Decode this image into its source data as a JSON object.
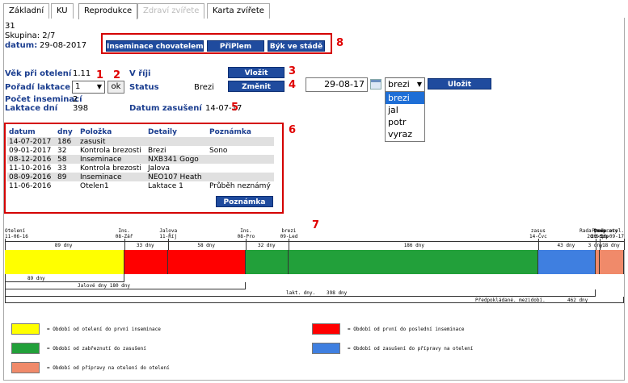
{
  "tabs": [
    {
      "label": "Základní",
      "state": "normal"
    },
    {
      "label": "KU",
      "state": "normal"
    },
    {
      "label": "Reprodukce",
      "state": "active"
    },
    {
      "label": "Zdraví zvířete",
      "state": "disabled"
    },
    {
      "label": "Karta zvířete",
      "state": "normal"
    }
  ],
  "header": {
    "number": "31",
    "group": "Skupina: 2/7",
    "date_label": "datum:",
    "date_value": "29-08-2017"
  },
  "top_buttons": [
    "Inseminace chovatelem",
    "PřiPlem",
    "Býk ve stádě"
  ],
  "form": {
    "age_label": "Věk při otelení",
    "age_value": "1.11",
    "heat_label": "V říji",
    "heat_button": "Vložit",
    "lact_order_label": "Pořadí laktace",
    "lact_order_value": "1",
    "ok_label": "ok",
    "status_label": "Status",
    "status_value": "Brezi",
    "change_button": "Změnit",
    "status_date": "29-08-17",
    "status_select": "brezi",
    "status_options": [
      "brezi",
      "jal",
      "potr",
      "vyraz"
    ],
    "save_button": "Uložit",
    "insem_count_label": "Počet inseminací",
    "insem_count_value": "2",
    "lact_days_label": "Laktace dní",
    "lact_days_value": "398",
    "conception_label": "Datum zasušení",
    "conception_value": "14-07-17"
  },
  "annotations": [
    "1",
    "2",
    "3",
    "4",
    "5",
    "6",
    "7",
    "8"
  ],
  "events_table": {
    "headers": [
      "datum",
      "dny",
      "Položka",
      "Detaily",
      "Poznámka"
    ],
    "rows": [
      [
        "14-07-2017",
        "186",
        "zasusit",
        "",
        ""
      ],
      [
        "09-01-2017",
        "32",
        "Kontrola brezosti",
        "Brezi",
        "Sono"
      ],
      [
        "08-12-2016",
        "58",
        "Inseminace",
        "NXB341 Gogo",
        ""
      ],
      [
        "11-10-2016",
        "33",
        "Kontrola brezosti",
        "Jalova",
        ""
      ],
      [
        "08-09-2016",
        "89",
        "Inseminace",
        "NEO107 Heath",
        ""
      ],
      [
        "11-06-2016",
        "",
        "Otelen1",
        "Laktace 1",
        "Průběh neznámý"
      ]
    ],
    "note_button": "Poznámka"
  },
  "timeline": {
    "top_labels": [
      {
        "l1": "Otelení",
        "l2": "11-06-16"
      },
      {
        "l1": "Ins.",
        "l2": "08-Zář"
      },
      {
        "l1": "Jalova",
        "l2": "11-Říj"
      },
      {
        "l1": "Ins.",
        "l2": "08-Pro"
      },
      {
        "l1": "brezi",
        "l2": "09-Led"
      },
      {
        "l1": "zasus",
        "l2": "14-Čvc"
      },
      {
        "l1": "Rada pripravy",
        "l2": "26-Srp"
      },
      {
        "l1": "Dnes",
        "l2": "29-Srp"
      },
      {
        "l1": "Predp.otel.",
        "l2": "16-09-17"
      }
    ],
    "day_labels": [
      "89 dny",
      "33 dny",
      "58 dny",
      "32 dny",
      "186 dny",
      "43 dny",
      "3 dny",
      "18 dny"
    ],
    "segments": [
      {
        "days": 89,
        "color": "#ffff00"
      },
      {
        "days": 33,
        "color": "#ff0000"
      },
      {
        "days": 58,
        "color": "#ff0000"
      },
      {
        "days": 32,
        "color": "#22a03a"
      },
      {
        "days": 186,
        "color": "#22a03a"
      },
      {
        "days": 43,
        "color": "#3f7fe0"
      },
      {
        "days": 3,
        "color": "#f08a6a"
      },
      {
        "days": 18,
        "color": "#f08a6a"
      }
    ],
    "below_1": "89 dny",
    "below_2": "Jalové dny 180 dny",
    "below_3_label": "lakt. dny.",
    "below_3_value": "398 dny",
    "below_4_label": "Předpokládané. mezidobí.",
    "below_4_value": "462 dny"
  },
  "legend": [
    {
      "color": "#ffff00",
      "text": "= Období od otelení do první inseminace"
    },
    {
      "color": "#ff0000",
      "text": "= Období od první do poslední inseminace"
    },
    {
      "color": "#22a03a",
      "text": "= Období od zabřeznutí do zasušení"
    },
    {
      "color": "#3f7fe0",
      "text": "= Období od zasušení do přípravy na otelení"
    },
    {
      "color": "#f08a6a",
      "text": "= Období od přípravy na otelení do otelení"
    }
  ]
}
